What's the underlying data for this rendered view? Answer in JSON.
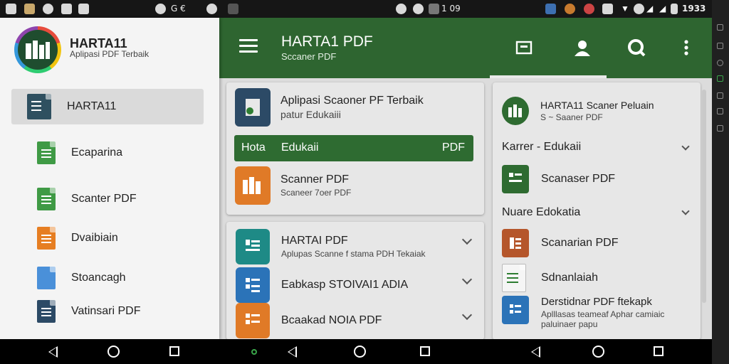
{
  "status_bar": {
    "left_text": "G €",
    "center_text": "1 09",
    "time": "1933"
  },
  "drawer": {
    "title": "HARTA11",
    "subtitle": "Aplipasi PDF Terbaik",
    "items": [
      {
        "label": "HARTA11",
        "icon": "document-icon"
      },
      {
        "label": "Ecaparina",
        "icon": "sheet-icon"
      },
      {
        "label": "Scanter PDF",
        "icon": "sheet-icon"
      },
      {
        "label": "Dvaibiain",
        "icon": "notes-icon"
      },
      {
        "label": "Stoancagh",
        "icon": "image-icon"
      },
      {
        "label": "Vatinsari PDF",
        "icon": "document-icon"
      }
    ]
  },
  "app_bar": {
    "title": "HARTA1 PDF",
    "subtitle": "Sccaner PDF"
  },
  "card_top": {
    "item1": {
      "title": "Aplipasi Scaoner PF Terbaik",
      "subtitle": "patur Edukaiii"
    },
    "highlight": {
      "left": "Hota",
      "middle": "Edukaii",
      "right": "PDF"
    },
    "item2": {
      "title": "Scanner PDF",
      "subtitle": "Scaneer 7oer PDF"
    }
  },
  "card_list": [
    {
      "title": "HARTAI PDF",
      "subtitle": "Aplupas Scanne f stama PDH Tekaiak"
    },
    {
      "title": "Eabkasp STOIVAI1 ADIA",
      "subtitle": ""
    },
    {
      "title": "Bcaakad  NOIA PDF",
      "subtitle": ""
    }
  ],
  "right_panel": {
    "header": {
      "title": "HARTA11 Scaner Peluain",
      "subtitle": "S ~ Saaner PDF"
    },
    "section1": "Karrer - Edukaii",
    "item1": "Scanaser PDF",
    "section2": "Nuare  Edokatia",
    "item2": "Scanarian PDF",
    "item3": "Sdnanlaiah",
    "item4": {
      "title": "Derstidnar PDF ftekapk",
      "line2": "Aplllasas teameaf Aphar camiaic",
      "line3": "paluinaer papu"
    }
  },
  "colors": {
    "primary": "#2e6530",
    "accent_orange": "#e07a27",
    "accent_blue": "#2b73b8",
    "accent_teal": "#1e8a86"
  }
}
